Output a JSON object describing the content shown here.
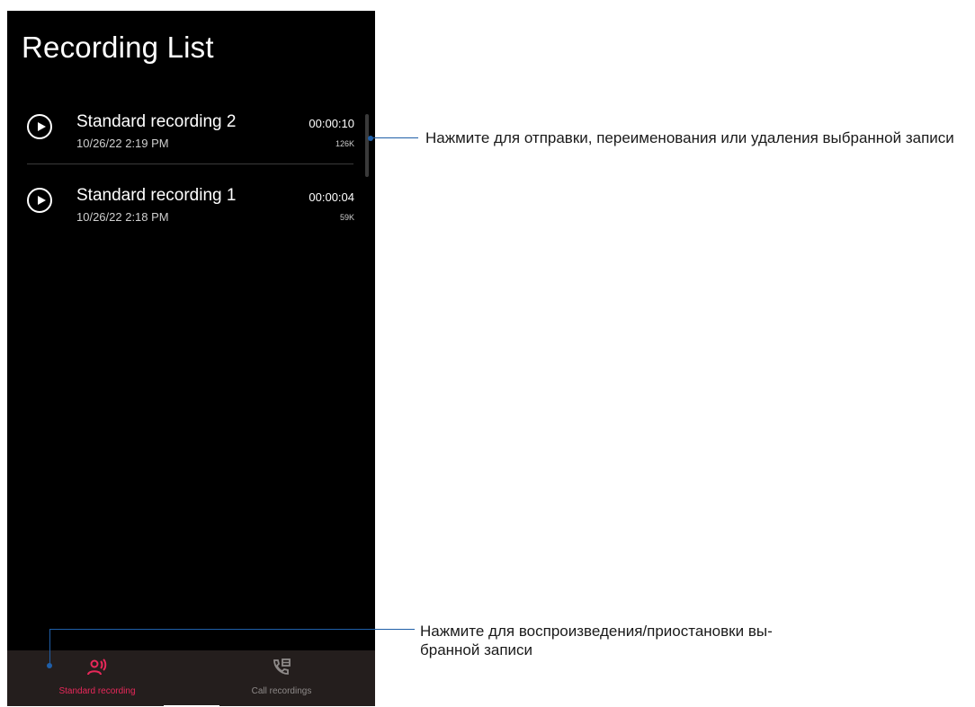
{
  "header": {
    "title": "Recording List"
  },
  "recordings": [
    {
      "name": "Standard recording 2",
      "date": "10/26/22 2:19 PM",
      "duration": "00:00:10",
      "size": "126K"
    },
    {
      "name": "Standard recording 1",
      "date": "10/26/22 2:18 PM",
      "duration": "00:00:04",
      "size": "59K"
    }
  ],
  "bottom_nav": {
    "tabs": [
      {
        "label": "Standard recording",
        "icon": "microphone-person-icon",
        "active": true
      },
      {
        "label": "Call recordings",
        "icon": "phone-call-icon",
        "active": false
      }
    ]
  },
  "annotations": {
    "top": "Нажмите для отправки, переименования или удаления выбранной записи",
    "bottom_line1": "Нажмите для воспроизведения/приостановки вы-",
    "bottom_line2": "бранной записи"
  },
  "colors": {
    "accent": "#e8285a",
    "nav_bg": "#241e1d",
    "callout": "#1f5fa8"
  }
}
